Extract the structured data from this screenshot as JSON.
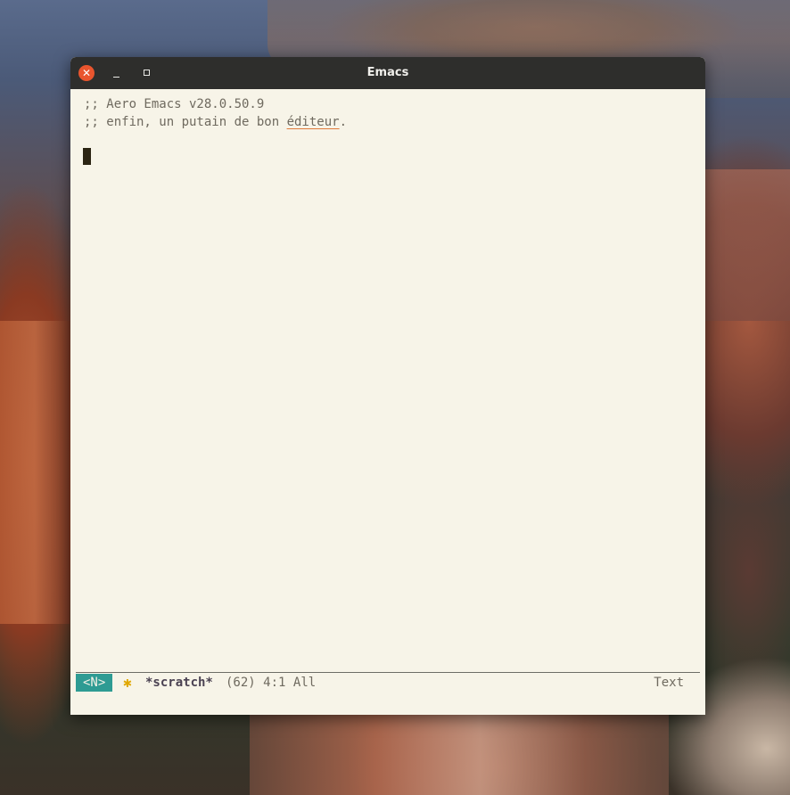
{
  "window": {
    "title": "Emacs"
  },
  "buffer": {
    "lines": [
      ";; Aero Emacs v28.0.50.9",
      ";; enfin, un putain de bon ",
      "éditeur",
      "."
    ]
  },
  "modeline": {
    "state": "<N>",
    "modified_icon": "✱",
    "buffer_name": "*scratch*",
    "size": "(62)",
    "position": "4:1",
    "scroll": "All",
    "major_mode": "Text"
  },
  "icons": {
    "close": "close-icon",
    "minimize": "minimize-icon",
    "maximize": "maximize-icon",
    "modified": "asterisk-icon"
  },
  "colors": {
    "titlebar": "#2e2e2c",
    "close_button": "#e9552e",
    "buffer_bg": "#f7f4e8",
    "state_badge": "#2e9b93",
    "modified_icon": "#e0a800",
    "spell_underline": "#e07a3a"
  }
}
